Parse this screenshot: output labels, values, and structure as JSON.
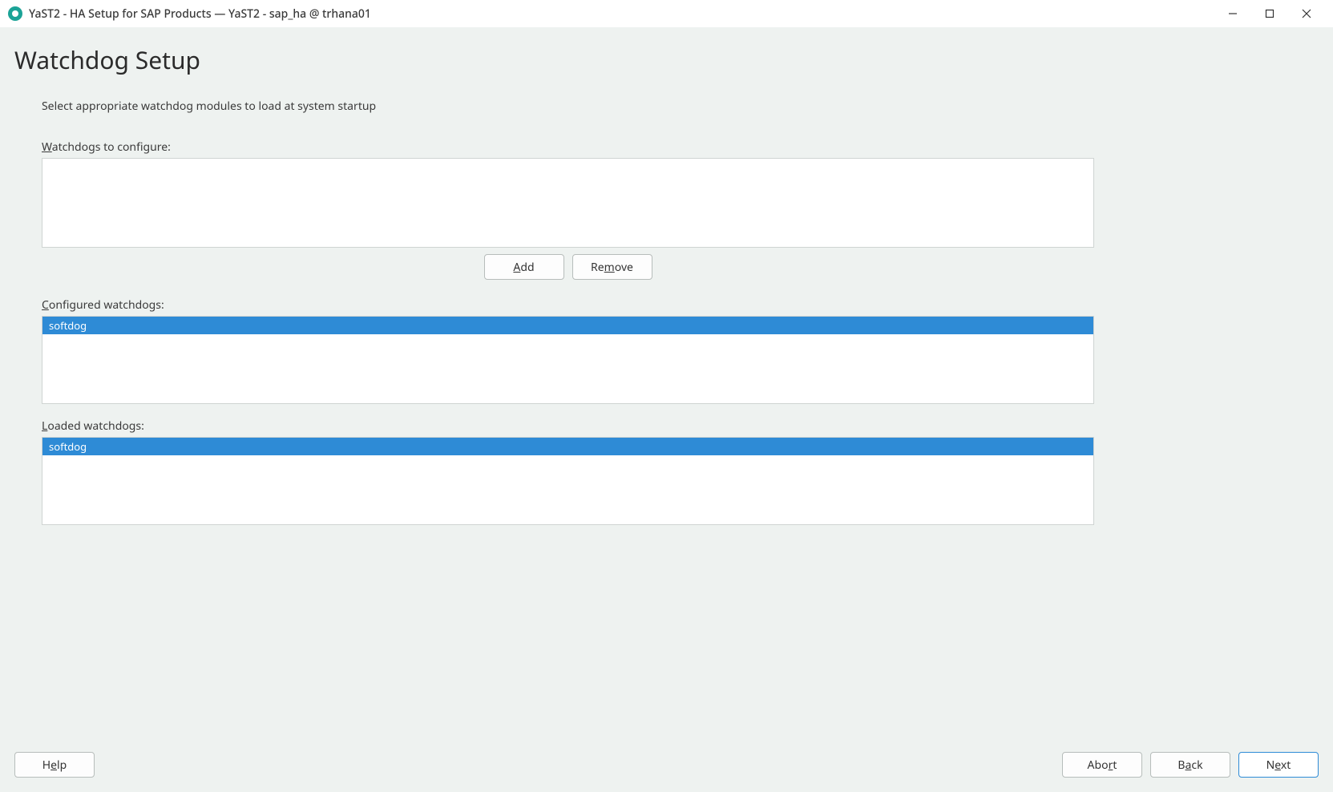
{
  "titlebar": {
    "text": "YaST2 - HA Setup for SAP Products — YaST2 - sap_ha @ trhana01"
  },
  "page": {
    "title": "Watchdog Setup",
    "instruction": "Select appropriate watchdog modules to load at system startup"
  },
  "labels": {
    "watchdogs_to_configure_pre": "W",
    "watchdogs_to_configure_post": "atchdogs to configure:",
    "configured_pre": "C",
    "configured_post": "onfigured watchdogs:",
    "loaded_pre": "L",
    "loaded_post": "oaded watchdogs:"
  },
  "lists": {
    "to_configure": [],
    "configured": [
      "softdog"
    ],
    "loaded": [
      "softdog"
    ]
  },
  "buttons": {
    "add_pre": "A",
    "add_post": "dd",
    "remove_pre": "Re",
    "remove_mid": "m",
    "remove_post": "ove",
    "help_pre": "H",
    "help_mid": "e",
    "help_post": "lp",
    "abort_pre": "Abo",
    "abort_mid": "r",
    "abort_post": "t",
    "back_pre": "B",
    "back_mid": "a",
    "back_post": "ck",
    "next_pre": "N",
    "next_mid": "e",
    "next_post": "xt"
  }
}
